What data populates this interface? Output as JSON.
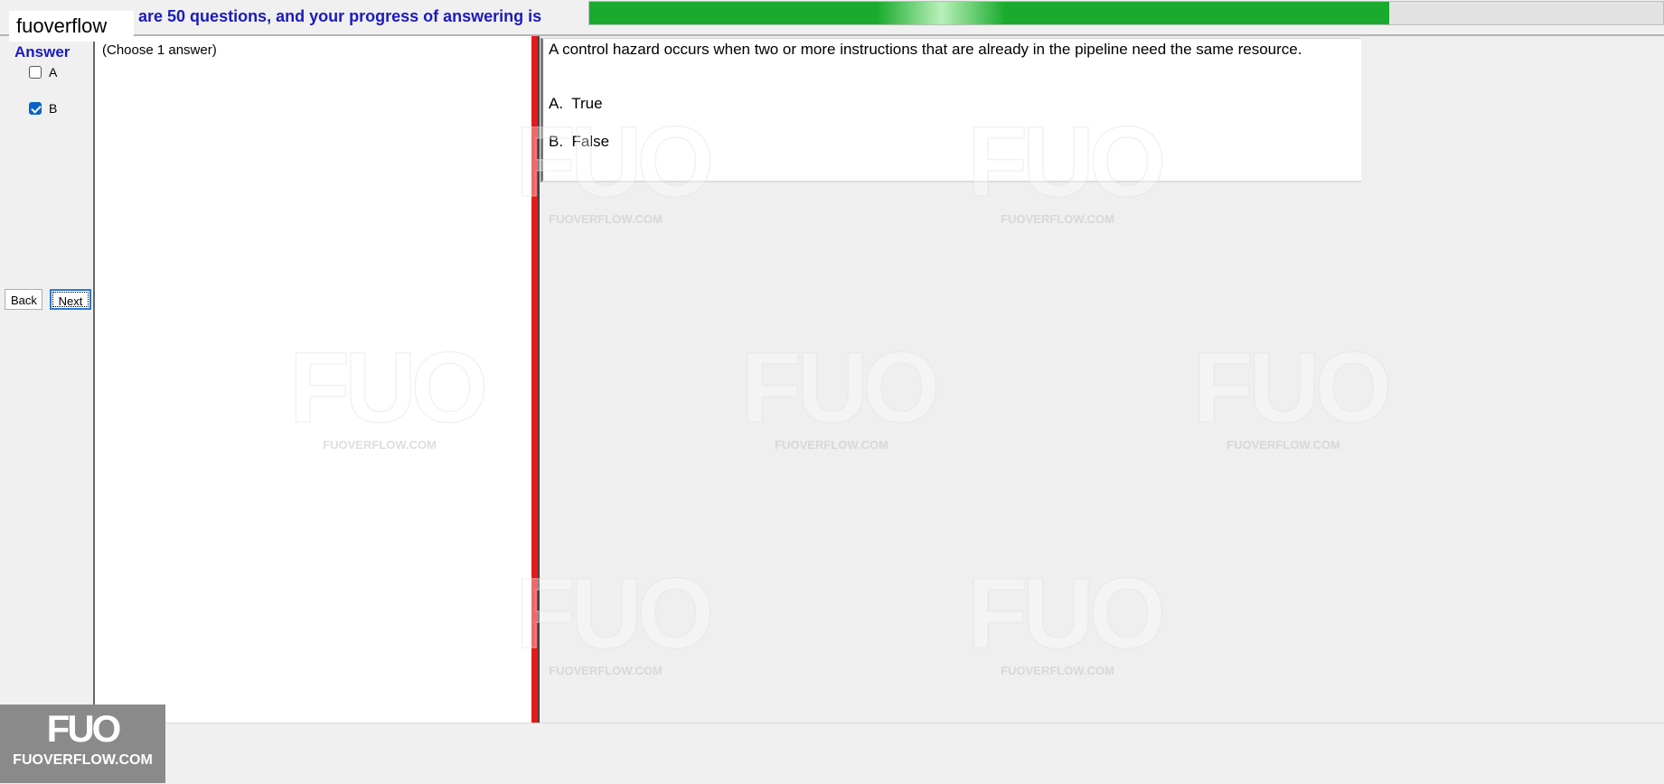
{
  "site_label": "fuoverflow",
  "header": {
    "progress_text": "e are 50 questions, and your progress of answering is",
    "progress_fraction": 0.745
  },
  "left_panel": {
    "answer_heading": "Answer",
    "options": [
      {
        "label": "A",
        "checked": false
      },
      {
        "label": "B",
        "checked": true
      }
    ],
    "back_label": "Back",
    "next_label": "Next"
  },
  "choose_text": "(Choose 1 answer)",
  "question": {
    "text": "A control hazard occurs when two or more instructions that are already in the pipeline need the same resource.",
    "options": [
      {
        "letter": "A.",
        "text": "True"
      },
      {
        "letter": "B.",
        "text": "False"
      }
    ]
  },
  "watermark": {
    "big": "FUO",
    "small": "FUOVERFLOW.COM"
  },
  "logo": {
    "big": "FUO",
    "small": "FUOVERFLOW.COM"
  }
}
